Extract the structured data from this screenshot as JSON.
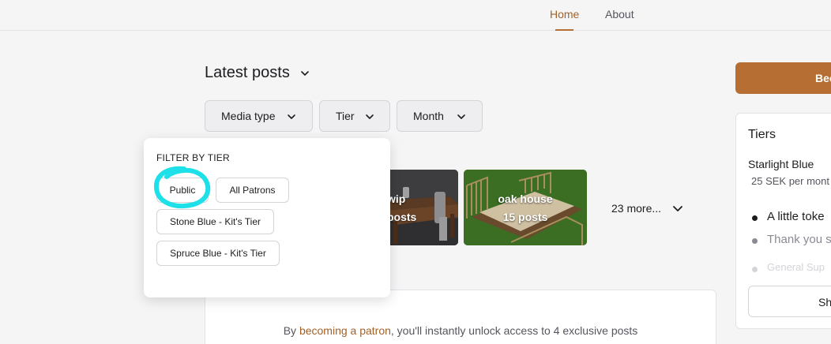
{
  "nav": {
    "home": "Home",
    "about": "About"
  },
  "feed": {
    "title": "Latest posts",
    "filters": {
      "media_type": "Media type",
      "tier": "Tier",
      "month": "Month"
    },
    "collections": [
      {
        "name": "wip",
        "count": "posts"
      },
      {
        "name": "oak house",
        "count": "15 posts"
      }
    ],
    "more": "23 more...",
    "unlock": {
      "prefix": "By ",
      "link": "becoming a patron",
      "suffix": ", you'll instantly unlock access to 4 exclusive posts"
    }
  },
  "dropdown": {
    "heading": "FILTER BY TIER",
    "options": [
      "Public",
      "All Patrons",
      "Stone Blue - Kit's Tier",
      "Spruce Blue - Kit's Tier"
    ]
  },
  "sidebar": {
    "become_button": "Bec",
    "tiers_heading": "Tiers",
    "tier_name": "Starlight Blue",
    "tier_price": "25 SEK per mont",
    "benefits": [
      "A little toke",
      "Thank you s",
      "General Sup"
    ],
    "show_button": "Sh"
  },
  "colors": {
    "accent": "#b66e32",
    "link": "#a1622a",
    "annotation": "#1de0e8"
  }
}
